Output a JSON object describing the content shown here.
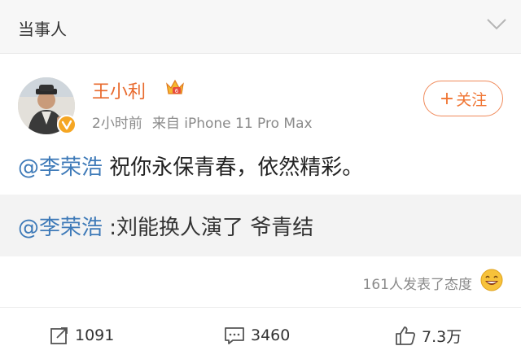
{
  "header": {
    "title": "当事人",
    "chevron_icon": "chevron-down-icon"
  },
  "post": {
    "username": "王小利",
    "username_color": "#e8692c",
    "badge_icon": "crown-badge-icon",
    "verified_icon": "verified-v-icon",
    "time": "2小时前",
    "source": "来自 iPhone 11 Pro Max",
    "follow_label": "关注",
    "follow_plus": "+",
    "content": {
      "mention": "@李荣浩",
      "text": " 祝你永保青春，依然精彩。"
    },
    "quoted": {
      "mention": "@李荣浩",
      "text": " :刘能换人演了 爷青结"
    },
    "attitude": {
      "text": "161人发表了态度",
      "icon": "laughing-emoji-icon"
    },
    "actions": {
      "repost": {
        "icon": "repost-icon",
        "count": "1091"
      },
      "comment": {
        "icon": "comment-icon",
        "count": "3460"
      },
      "like": {
        "icon": "thumbs-up-icon",
        "count": "7.3万"
      }
    }
  },
  "colors": {
    "mention": "#3e7ab8",
    "accent": "#f07533",
    "meta": "#8a8a8a"
  }
}
